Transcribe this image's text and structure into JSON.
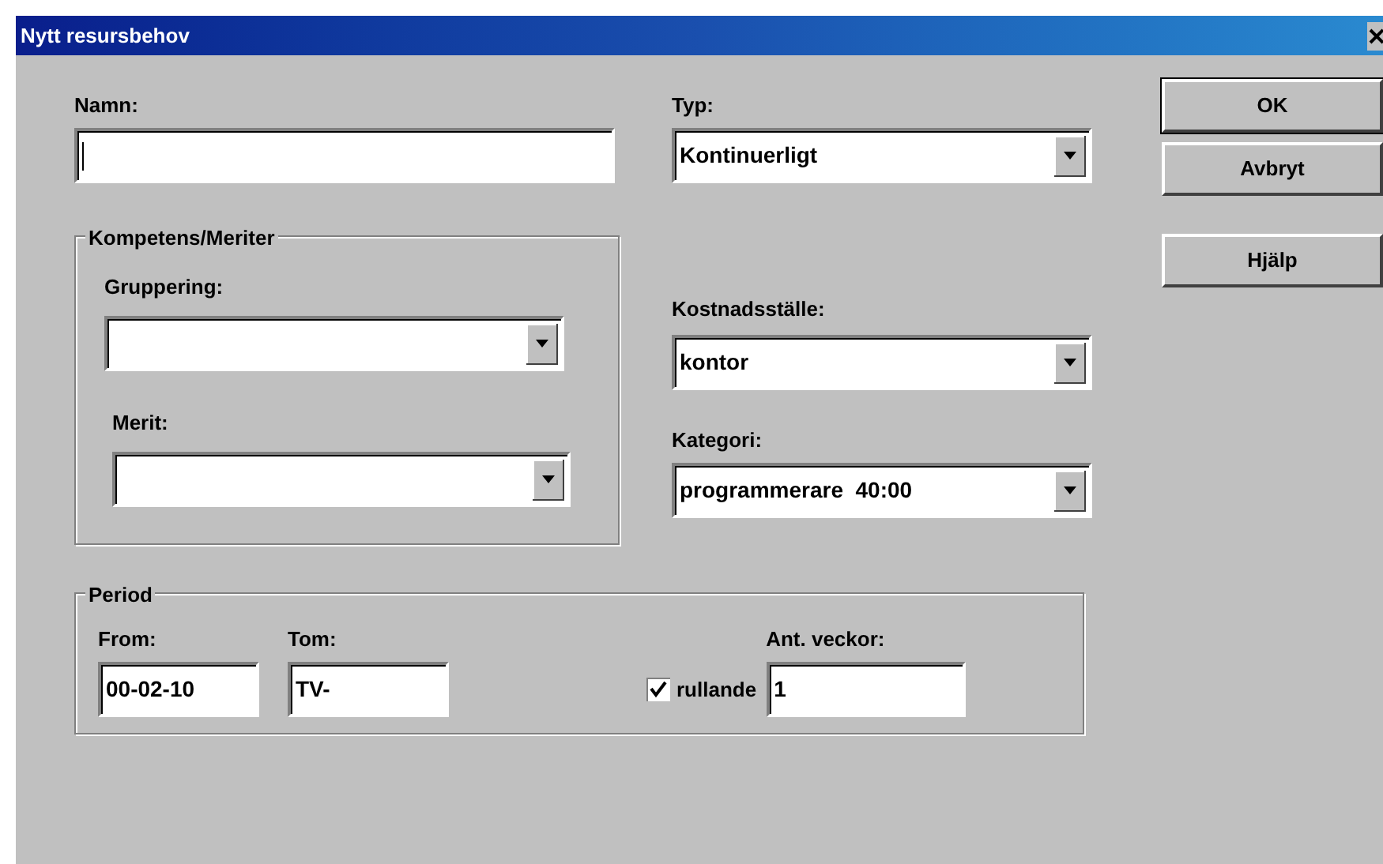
{
  "window": {
    "title": "Nytt resursbehov"
  },
  "name_field": {
    "label": "Namn:",
    "focused": true
  },
  "type_field": {
    "label": "Typ:",
    "value": "Kontinuerligt"
  },
  "competence_group": {
    "title": "Kompetens/Meriter",
    "grouping": {
      "label": "Gruppering:"
    },
    "merit": {
      "label": "Merit:"
    }
  },
  "cost_center": {
    "label": "Kostnadsställe:",
    "value": "kontor"
  },
  "category": {
    "label": "Kategori:",
    "value": "programmerare  40:00"
  },
  "buttons": [
    {
      "label": "OK",
      "default": true
    },
    {
      "label": "Avbryt",
      "default": false
    },
    {
      "label": "Hjälp",
      "default": false
    }
  ],
  "period": {
    "title": "Period",
    "from": {
      "label": "From:",
      "value": "00-02-10"
    },
    "to": {
      "label": "Tom:",
      "value": "TV-"
    },
    "rolling": {
      "label": "rullande",
      "checked": true
    },
    "weeks": {
      "label": "Ant. veckor:",
      "value": "1"
    }
  }
}
